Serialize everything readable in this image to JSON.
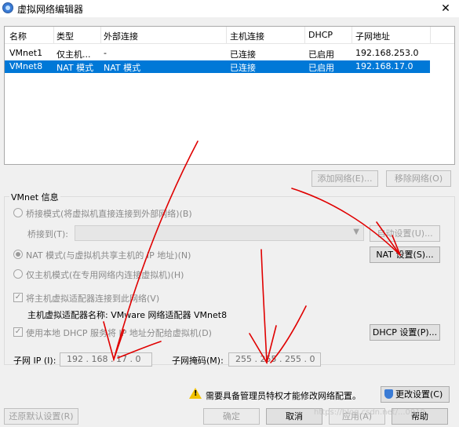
{
  "window": {
    "title": "虚拟网络编辑器",
    "close": "✕"
  },
  "table": {
    "headers": [
      "名称",
      "类型",
      "外部连接",
      "主机连接",
      "DHCP",
      "子网地址"
    ],
    "rows": [
      [
        "VMnet1",
        "仅主机...",
        "-",
        "已连接",
        "已启用",
        "192.168.253.0"
      ],
      [
        "VMnet8",
        "NAT 模式",
        "NAT 模式",
        "已连接",
        "已启用",
        "192.168.17.0"
      ]
    ],
    "selected_row": 1
  },
  "buttons": {
    "add_network": "添加网络(E)...",
    "remove_network": "移除网络(O)",
    "auto_settings": "自动设置(U)...",
    "nat_settings": "NAT 设置(S)...",
    "dhcp_settings": "DHCP 设置(P)...",
    "change_settings": "更改设置(C)",
    "restore_defaults": "还原默认设置(R)",
    "ok": "确定",
    "cancel": "取消",
    "apply": "应用(A)",
    "help": "帮助"
  },
  "vmnet_info": {
    "group_title": "VMnet 信息",
    "bridged_mode": "桥接模式(将虚拟机直接连接到外部网络)(B)",
    "bridged_to": "桥接到(T):",
    "nat_mode": "NAT 模式(与虚拟机共享主机的 IP 地址)(N)",
    "host_only_mode": "仅主机模式(在专用网络内连接虚拟机)(H)",
    "connect_adapter": "将主机虚拟适配器连接到此网络(V)",
    "adapter_name": "主机虚拟适配器名称: VMware 网络适配器 VMnet8",
    "use_dhcp": "使用本地 DHCP 服务将 IP 地址分配给虚拟机(D)",
    "subnet_ip_label": "子网 IP (I):",
    "subnet_ip": "192 . 168 . 17 . 0",
    "subnet_mask_label": "子网掩码(M):",
    "subnet_mask": "255 . 255 . 255 . 0",
    "selected_mode": "nat"
  },
  "warning": {
    "text": "需要具备管理员特权才能修改网络配置。"
  },
  "watermark": "https://blog.csdn.net/...0919"
}
